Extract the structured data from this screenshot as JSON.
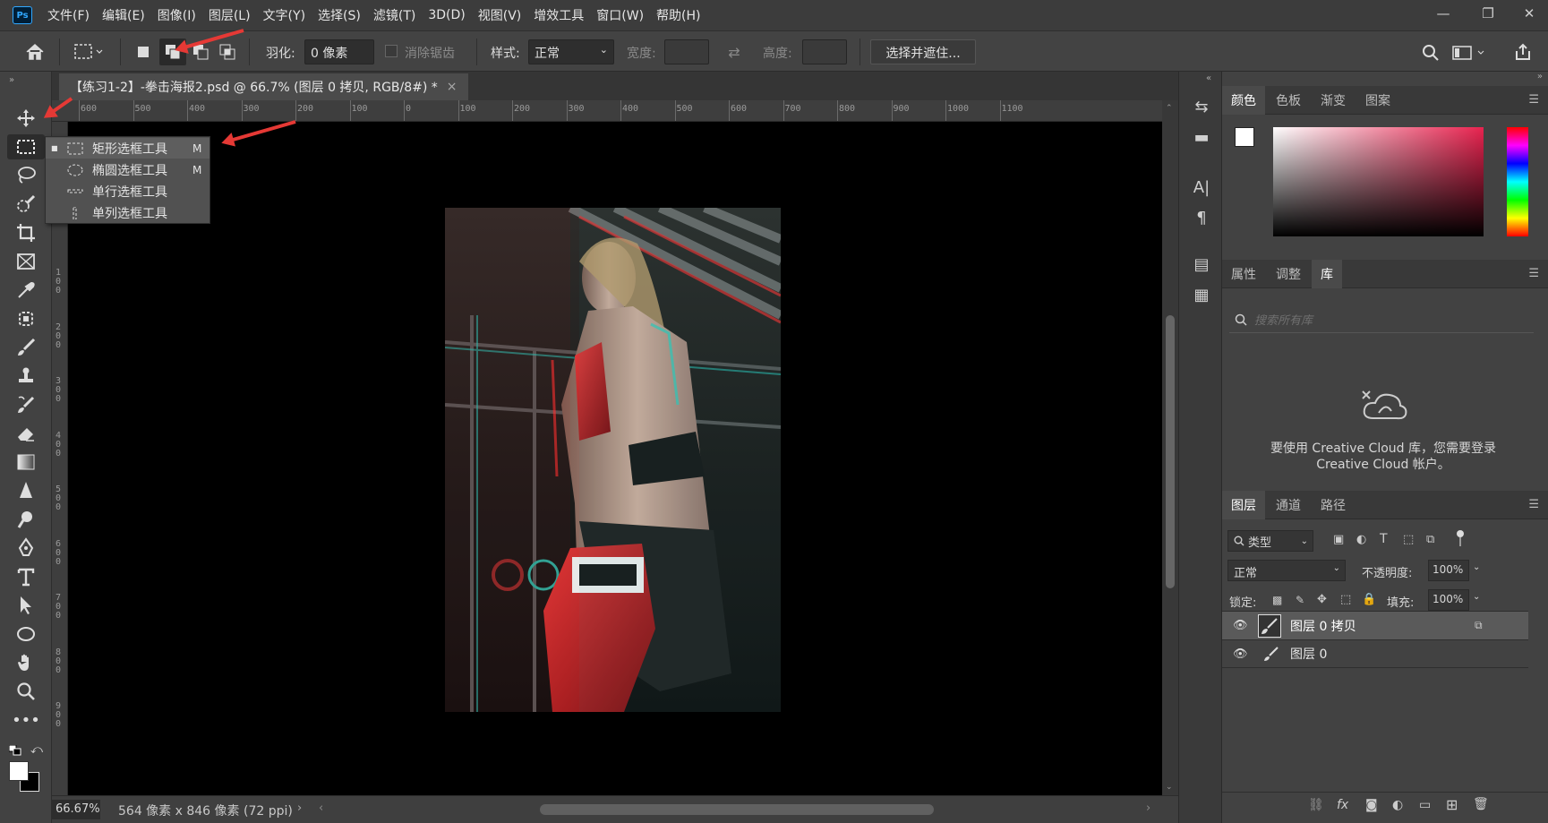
{
  "app": {
    "logo": "Ps"
  },
  "menu": [
    "文件(F)",
    "编辑(E)",
    "图像(I)",
    "图层(L)",
    "文字(Y)",
    "选择(S)",
    "滤镜(T)",
    "3D(D)",
    "视图(V)",
    "增效工具",
    "窗口(W)",
    "帮助(H)"
  ],
  "window_controls": {
    "minimize": "—",
    "maximize": "❐",
    "close": "✕"
  },
  "options": {
    "feather_label": "羽化:",
    "feather_value": "0 像素",
    "antialias_label": "消除锯齿",
    "style_label": "样式:",
    "style_value": "正常",
    "width_label": "宽度:",
    "height_label": "高度:",
    "select_mask_button": "选择并遮住..."
  },
  "document": {
    "tab_title": "【练习1-2】-拳击海报2.psd @ 66.7% (图层 0 拷贝, RGB/8#) *",
    "close_glyph": "×"
  },
  "rulers": {
    "h_labels": [
      "600",
      "500",
      "400",
      "300",
      "200",
      "100",
      "0",
      "100",
      "200",
      "300",
      "400",
      "500",
      "600",
      "700",
      "800",
      "900",
      "1000",
      "1100"
    ],
    "v_labels": [
      "1\n0\n0",
      "2\n0\n0",
      "3\n0\n0",
      "4\n0\n0",
      "5\n0\n0",
      "6\n0\n0",
      "7\n0\n0",
      "8\n0\n0",
      "9\n0\n0"
    ]
  },
  "tool_flyout": [
    {
      "label": "矩形选框工具",
      "key": "M",
      "selected": true,
      "icon": "rect-marquee-icon"
    },
    {
      "label": "椭圆选框工具",
      "key": "M",
      "selected": false,
      "icon": "ellipse-marquee-icon"
    },
    {
      "label": "单行选框工具",
      "key": "",
      "selected": false,
      "icon": "single-row-marquee-icon"
    },
    {
      "label": "单列选框工具",
      "key": "",
      "selected": false,
      "icon": "single-column-marquee-icon"
    }
  ],
  "status": {
    "zoom": "66.67%",
    "doc_info": "564 像素 x 846 像素 (72 ppi)"
  },
  "panels": {
    "color_tabs": [
      "颜色",
      "色板",
      "渐变",
      "图案"
    ],
    "props_tabs": [
      "属性",
      "调整",
      "库"
    ],
    "library": {
      "search_placeholder": "搜索所有库",
      "message": "要使用 Creative Cloud 库，您需要登录 Creative Cloud 帐户。"
    },
    "layers_tabs": [
      "图层",
      "通道",
      "路径"
    ],
    "layers": {
      "filter_kind": "类型",
      "blend_mode": "正常",
      "opacity_label": "不透明度:",
      "opacity_value": "100%",
      "lock_label": "锁定:",
      "fill_label": "填充:",
      "fill_value": "100%",
      "items": [
        {
          "name": "图层 0 拷贝",
          "selected": true
        },
        {
          "name": "图层 0",
          "selected": false
        }
      ],
      "footer_icons": [
        "link-icon",
        "fx-icon",
        "mask-icon",
        "adjustment-icon",
        "group-icon",
        "new-layer-icon",
        "trash-icon"
      ]
    }
  },
  "colors": {
    "accent_red": "#e53935",
    "foreground": "#ffffff",
    "hue": "#e8234f"
  }
}
